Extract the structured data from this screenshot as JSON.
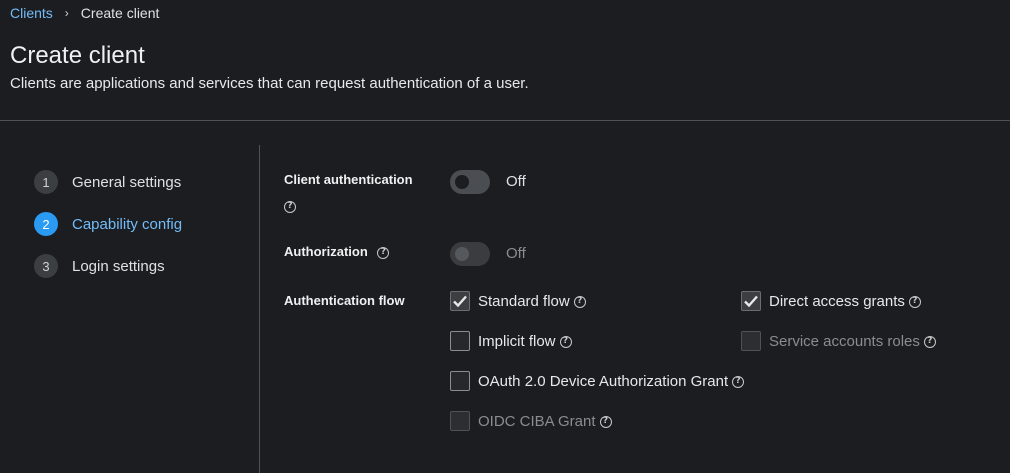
{
  "breadcrumb": {
    "parent": "Clients",
    "separator": "›",
    "current": "Create client"
  },
  "header": {
    "title": "Create client",
    "description": "Clients are applications and services that can request authentication of a user."
  },
  "steps": [
    {
      "number": "1",
      "label": "General settings",
      "active": false
    },
    {
      "number": "2",
      "label": "Capability config",
      "active": true
    },
    {
      "number": "3",
      "label": "Login settings",
      "active": false
    }
  ],
  "form": {
    "client_authentication": {
      "label": "Client authentication",
      "state": "Off",
      "on": false,
      "disabled": false
    },
    "authorization": {
      "label": "Authorization",
      "state": "Off",
      "on": false,
      "disabled": true
    },
    "auth_flow": {
      "label": "Authentication flow",
      "options": {
        "standard_flow": {
          "label": "Standard flow",
          "checked": true,
          "disabled": false
        },
        "direct_access_grants": {
          "label": "Direct access grants",
          "checked": true,
          "disabled": false
        },
        "implicit_flow": {
          "label": "Implicit flow",
          "checked": false,
          "disabled": false
        },
        "service_accounts_roles": {
          "label": "Service accounts roles",
          "checked": false,
          "disabled": true
        },
        "oauth_device_grant": {
          "label": "OAuth 2.0 Device Authorization Grant",
          "checked": false,
          "disabled": false
        },
        "oidc_ciba_grant": {
          "label": "OIDC CIBA Grant",
          "checked": false,
          "disabled": true
        }
      }
    }
  },
  "icons": {
    "help": "help-circle-icon",
    "check": "checkmark-icon",
    "chevron": "chevron-right-icon"
  },
  "colors": {
    "link": "#73bcf7",
    "active_step": "#2b9af3",
    "background": "#1b1d21"
  }
}
